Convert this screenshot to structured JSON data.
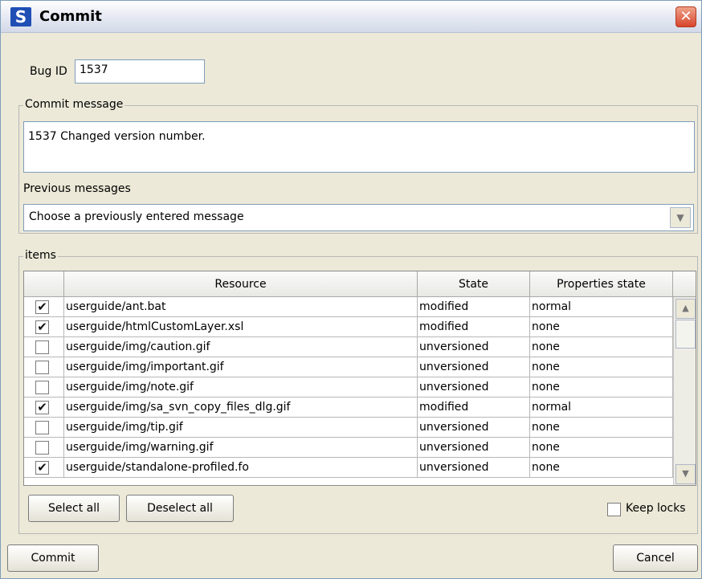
{
  "window": {
    "title": "Commit",
    "app_icon": "S"
  },
  "bug": {
    "label": "Bug ID",
    "value": "1537"
  },
  "commit_message": {
    "legend": "Commit message",
    "value": "1537 Changed version number."
  },
  "previous": {
    "label": "Previous messages",
    "selected": "Choose a previously entered message"
  },
  "items": {
    "legend": "items",
    "columns": [
      "Resource",
      "State",
      "Properties state"
    ],
    "rows": [
      {
        "checked": true,
        "resource": "userguide/ant.bat",
        "state": "modified",
        "props": "normal"
      },
      {
        "checked": true,
        "resource": "userguide/htmlCustomLayer.xsl",
        "state": "modified",
        "props": "none"
      },
      {
        "checked": false,
        "resource": "userguide/img/caution.gif",
        "state": "unversioned",
        "props": "none"
      },
      {
        "checked": false,
        "resource": "userguide/img/important.gif",
        "state": "unversioned",
        "props": "none"
      },
      {
        "checked": false,
        "resource": "userguide/img/note.gif",
        "state": "unversioned",
        "props": "none"
      },
      {
        "checked": true,
        "resource": "userguide/img/sa_svn_copy_files_dlg.gif",
        "state": "modified",
        "props": "normal"
      },
      {
        "checked": false,
        "resource": "userguide/img/tip.gif",
        "state": "unversioned",
        "props": "none"
      },
      {
        "checked": false,
        "resource": "userguide/img/warning.gif",
        "state": "unversioned",
        "props": "none"
      },
      {
        "checked": true,
        "resource": "userguide/standalone-profiled.fo",
        "state": "unversioned",
        "props": "none"
      }
    ],
    "check_glyph": "✔"
  },
  "buttons": {
    "select_all": "Select all",
    "deselect_all": "Deselect all",
    "keep_locks": "Keep locks",
    "commit": "Commit",
    "cancel": "Cancel"
  },
  "icons": {
    "close": "close-icon",
    "dropdown": "chevron-down-icon",
    "scroll_up": "arrow-up-icon",
    "scroll_down": "arrow-down-icon"
  }
}
